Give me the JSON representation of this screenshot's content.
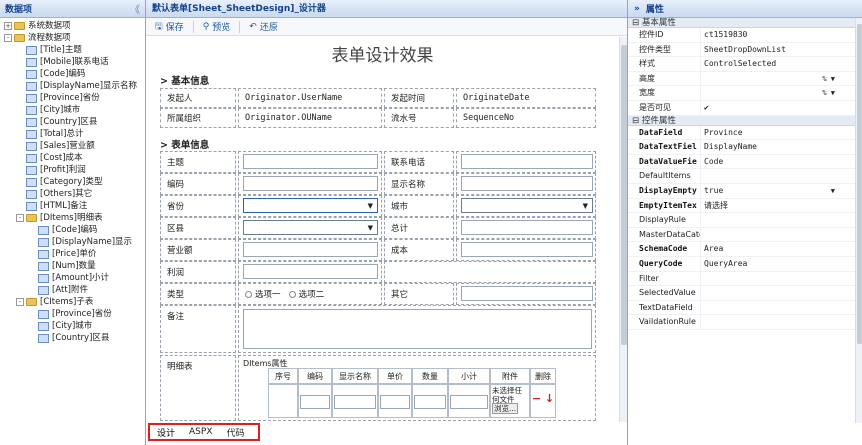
{
  "left": {
    "title": "数据项",
    "collapse": "《",
    "tree": [
      {
        "label": "系统数据项",
        "t": "fd",
        "lvl": 0,
        "tg": "+"
      },
      {
        "label": "流程数据项",
        "t": "fd",
        "lvl": 0,
        "tg": "-"
      },
      {
        "label": "[Title]主题",
        "t": "lf",
        "lvl": 1
      },
      {
        "label": "[Mobile]联系电话",
        "t": "lf",
        "lvl": 1
      },
      {
        "label": "[Code]编码",
        "t": "lf",
        "lvl": 1
      },
      {
        "label": "[DisplayName]显示名称",
        "t": "lf",
        "lvl": 1
      },
      {
        "label": "[Province]省份",
        "t": "lf",
        "lvl": 1
      },
      {
        "label": "[City]城市",
        "t": "lf",
        "lvl": 1
      },
      {
        "label": "[Country]区县",
        "t": "lf",
        "lvl": 1
      },
      {
        "label": "[Total]总计",
        "t": "lf",
        "lvl": 1
      },
      {
        "label": "[Sales]营业额",
        "t": "lf",
        "lvl": 1
      },
      {
        "label": "[Cost]成本",
        "t": "lf",
        "lvl": 1
      },
      {
        "label": "[Profit]利润",
        "t": "lf",
        "lvl": 1
      },
      {
        "label": "[Category]类型",
        "t": "lf",
        "lvl": 1
      },
      {
        "label": "[Others]其它",
        "t": "lf",
        "lvl": 1
      },
      {
        "label": "[HTML]备注",
        "t": "lf",
        "lvl": 1
      },
      {
        "label": "[DItems]明细表",
        "t": "fd",
        "lvl": 1,
        "tg": "-"
      },
      {
        "label": "[Code]编码",
        "t": "lf",
        "lvl": 2
      },
      {
        "label": "[DisplayName]显示",
        "t": "lf",
        "lvl": 2
      },
      {
        "label": "[Price]单价",
        "t": "lf",
        "lvl": 2
      },
      {
        "label": "[Num]数量",
        "t": "lf",
        "lvl": 2
      },
      {
        "label": "[Amount]小计",
        "t": "lf",
        "lvl": 2
      },
      {
        "label": "[Att]附件",
        "t": "lf",
        "lvl": 2
      },
      {
        "label": "[CItems]子表",
        "t": "fd",
        "lvl": 1,
        "tg": "-"
      },
      {
        "label": "[Province]省份",
        "t": "lf",
        "lvl": 2
      },
      {
        "label": "[City]城市",
        "t": "lf",
        "lvl": 2
      },
      {
        "label": "[Country]区县",
        "t": "lf",
        "lvl": 2
      }
    ]
  },
  "center": {
    "title": "默认表单[Sheet_SheetDesign]_设计器",
    "toolbar": {
      "save": "保存",
      "preview": "预览",
      "undo": "还原"
    },
    "form_title": "表单设计效果",
    "sec_basic": "基本信息",
    "sec_form": "表单信息",
    "basic": {
      "originator_label": "发起人",
      "originator_value": "Originator.UserName",
      "time_label": "发起时间",
      "time_value": "OriginateDate",
      "org_label": "所属组织",
      "org_value": "Originator.OUName",
      "seq_label": "流水号",
      "seq_value": "SequenceNo"
    },
    "fields": {
      "title": "主题",
      "mobile": "联系电话",
      "code": "编码",
      "display": "显示名称",
      "province": "省份",
      "city": "城市",
      "district": "区县",
      "total": "总计",
      "sales": "营业额",
      "cost": "成本",
      "profit": "利润",
      "category": "类型",
      "opt1": "选项一",
      "opt2": "选项二",
      "others": "其它",
      "remark": "备注",
      "detail": "明细表"
    },
    "detail": {
      "caption": "DItems属性",
      "headers": [
        "序号",
        "编码",
        "显示名称",
        "单价",
        "数量",
        "小计",
        "附件",
        "删除"
      ],
      "none_file": "未选择任何文件",
      "browse": "浏览..."
    },
    "tabs": [
      "设计",
      "ASPX",
      "代码"
    ]
  },
  "right": {
    "title": "属性",
    "expand": "»",
    "sec_basic": "基本属性",
    "sec_ctrl": "控件属性",
    "basic": [
      {
        "k": "控件ID",
        "v": "ct1519830"
      },
      {
        "k": "控件类型",
        "v": "SheetDropDownList"
      },
      {
        "k": "样式",
        "v": "ControlSelected"
      },
      {
        "k": "高度",
        "v": "",
        "d": "% ▼"
      },
      {
        "k": "宽度",
        "v": "",
        "d": "% ▼"
      },
      {
        "k": "是否可见",
        "v": "✔"
      }
    ],
    "ctrl": [
      {
        "k": "DataField",
        "v": "Province",
        "b": true
      },
      {
        "k": "DataTextFiel",
        "v": "DisplayName",
        "b": true
      },
      {
        "k": "DataValueFie",
        "v": "Code",
        "b": true
      },
      {
        "k": "DefaultItems",
        "v": ""
      },
      {
        "k": "DisplayEmpty",
        "v": "true",
        "b": true,
        "d": "▼"
      },
      {
        "k": "EmptyItemTex",
        "v": "请选择",
        "b": true
      },
      {
        "k": "DisplayRule",
        "v": ""
      },
      {
        "k": "MasterDataCateg",
        "v": ""
      },
      {
        "k": "SchemaCode",
        "v": "Area",
        "b": true
      },
      {
        "k": "QueryCode",
        "v": "QueryArea",
        "b": true
      },
      {
        "k": "Filter",
        "v": ""
      },
      {
        "k": "SelectedValue",
        "v": ""
      },
      {
        "k": "TextDataField",
        "v": ""
      },
      {
        "k": "VaildationRule",
        "v": ""
      }
    ]
  }
}
